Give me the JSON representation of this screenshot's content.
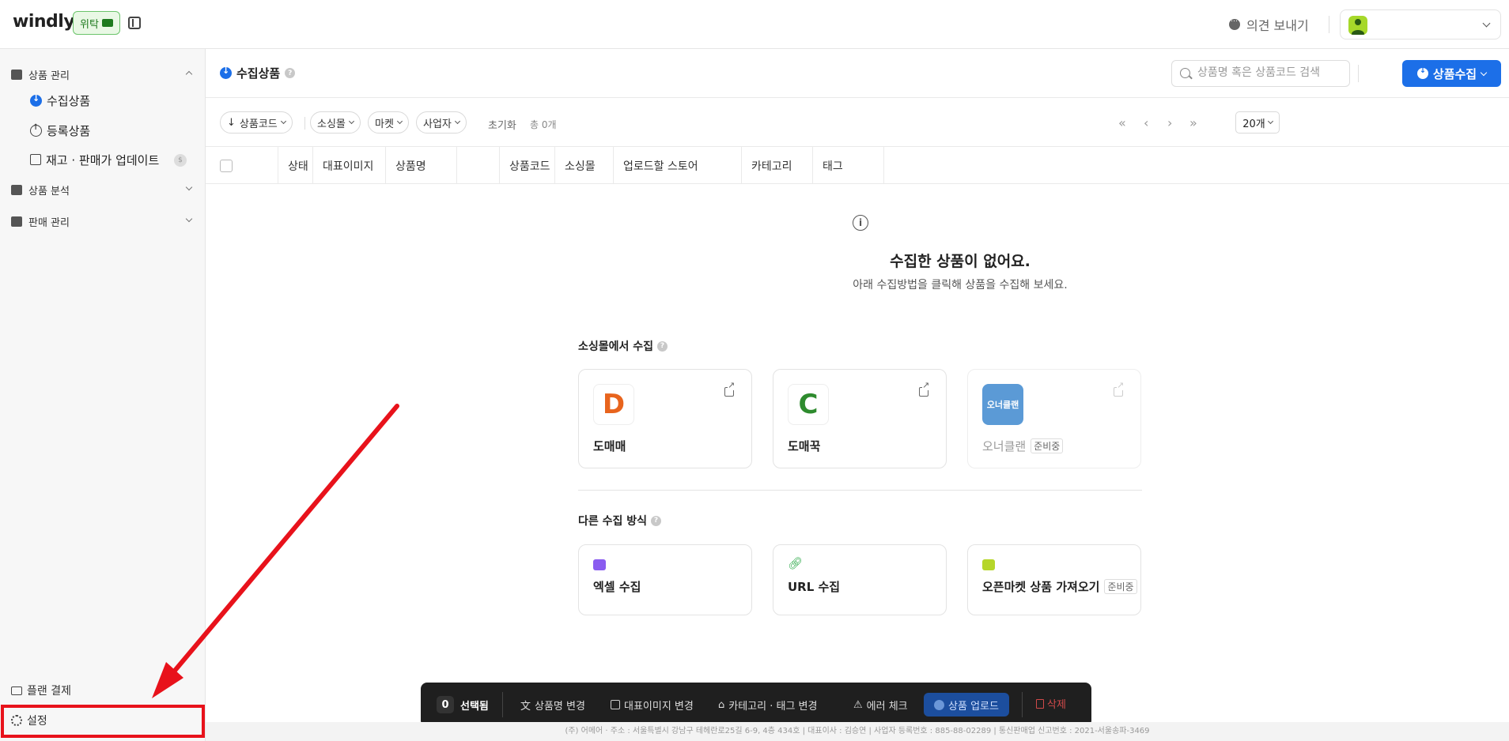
{
  "topbar": {
    "logo": "windly",
    "badge": "위탁",
    "feedback_label": "의견 보내기"
  },
  "sidebar": {
    "groups": [
      {
        "label": "상품 관리",
        "expanded": true,
        "items": [
          {
            "label": "수집상품",
            "active": true
          },
          {
            "label": "등록상품"
          },
          {
            "label": "재고 · 판매가 업데이트"
          }
        ]
      },
      {
        "label": "상품 분석",
        "expanded": false
      },
      {
        "label": "판매 관리",
        "expanded": false
      }
    ],
    "bottom": {
      "plan_label": "플랜 결제",
      "settings_label": "설정"
    }
  },
  "header": {
    "title": "수집상품",
    "help": "?",
    "search_placeholder": "상품명 혹은 상품코드 검색",
    "collect_button": "상품수집"
  },
  "filters": {
    "sort_label": "상품코드",
    "pills": [
      "소싱몰",
      "마켓",
      "사업자"
    ],
    "reset_label": "초기화",
    "total_label": "총 0개",
    "pager": [
      "«",
      "‹",
      "›",
      "»"
    ],
    "page_size": "20개"
  },
  "table": {
    "columns": [
      "상태",
      "대표이미지",
      "상품명",
      "",
      "상품코드",
      "소싱몰",
      "업로드할 스토어",
      "카테고리",
      "태그"
    ]
  },
  "empty_state": {
    "icon": "info-icon",
    "title": "수집한 상품이 없어요.",
    "subtitle": "아래 수집방법을 클릭해 상품을 수집해 보세요."
  },
  "sourcing": {
    "title": "소싱몰에서 수집",
    "cards": [
      {
        "name": "도매매",
        "logo_text": "D",
        "status": ""
      },
      {
        "name": "도매꾹",
        "logo_text": "C",
        "status": ""
      },
      {
        "name": "오너클랜",
        "logo_text": "오너클랜",
        "status": "준비중"
      }
    ]
  },
  "other_methods": {
    "title": "다른 수집 방식",
    "cards": [
      {
        "name": "엑셀 수집",
        "icon": "folder-icon",
        "status": ""
      },
      {
        "name": "URL 수집",
        "icon": "link-icon",
        "status": ""
      },
      {
        "name": "오픈마켓 상품 가져오기",
        "icon": "archive-icon",
        "status": "준비중"
      }
    ]
  },
  "action_bar": {
    "count": "0",
    "selected_label": "선택됨",
    "rename": "상품명 변경",
    "image_change": "대표이미지 변경",
    "category_tag": "카테고리 · 태그 변경",
    "error_check": "에러 체크",
    "upload": "상품 업로드",
    "delete": "삭제"
  },
  "footer_text": "(주) 어메어 · 주소 : 서울특별시 강남구 테헤란로25길 6-9, 4층 434호 | 대표이사 : 김승연 | 사업자 등록번호 : 885-88-02289 | 통신판매업 신고번호 : 2021-서울송파-3469",
  "colors": {
    "accent": "#1c6fe8",
    "annotation": "#e8121b",
    "badge_green": "#1e7a1e"
  }
}
